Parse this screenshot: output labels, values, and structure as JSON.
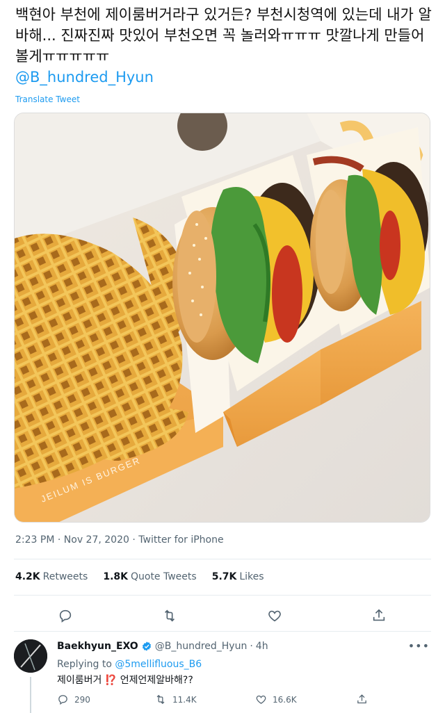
{
  "tweet": {
    "text": "백현아 부천에 제이룸버거라구 있거든? 부천시청역에 있는데 내가 알바해... 진짜진짜 맛있어 부천오면 꼭 놀러와ㅠㅠㅠ 맛깔나게 만들어볼게ㅠㅠㅠㅠㅠ",
    "mention": "@B_hundred_Hyun",
    "translate_label": "Translate Tweet",
    "photo_box_text": "JEILUM IS BURGER",
    "time": "2:23 PM",
    "date": "Nov 27, 2020",
    "source": "Twitter for iPhone",
    "separator": "·"
  },
  "stats": {
    "retweets": {
      "count": "4.2K",
      "label": "Retweets"
    },
    "quotes": {
      "count": "1.8K",
      "label": "Quote Tweets"
    },
    "likes": {
      "count": "5.7K",
      "label": "Likes"
    }
  },
  "reply": {
    "name": "Baekhyun_EXO",
    "handle": "@B_hundred_Hyun",
    "age": "4h",
    "replying_prefix": "Replying to",
    "replying_to": "@5mellifluous_B6",
    "text": "제이룸버거 ⁉️ 언제언제알바해??",
    "counts": {
      "replies": "290",
      "retweets": "11.4K",
      "likes": "16.6K"
    }
  },
  "colors": {
    "accent": "#1d9bf0",
    "muted": "#536471",
    "box_orange": "#f2a94a"
  }
}
